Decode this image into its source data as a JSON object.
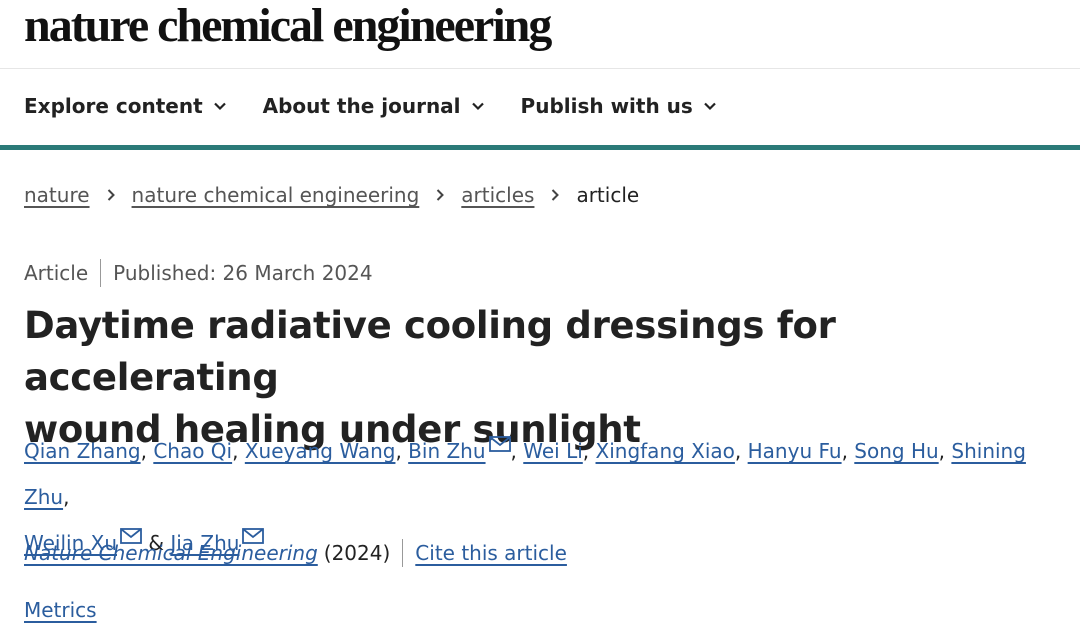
{
  "brand": {
    "name": "nature chemical engineering"
  },
  "nav": {
    "items": [
      {
        "label": "Explore content"
      },
      {
        "label": "About the journal"
      },
      {
        "label": "Publish with us"
      }
    ]
  },
  "breadcrumb": {
    "links": [
      "nature",
      "nature chemical engineering",
      "articles"
    ],
    "current": "article"
  },
  "meta": {
    "type": "Article",
    "published": "Published: 26 March 2024"
  },
  "article": {
    "title_line1": "Daytime radiative cooling dressings for accelerating",
    "title_line2": "wound healing under sunlight"
  },
  "authors": {
    "list": [
      "Qian Zhang",
      "Chao Qi",
      "Xueyang Wang",
      "Bin Zhu",
      "Wei Li",
      "Xingfang Xiao",
      "Hanyu Fu",
      "Song Hu",
      "Shining Zhu",
      "Weilin Xu",
      "Jia Zhu"
    ],
    "comma": ",",
    "ampersand": "&",
    "mail_icon": "mail-icon"
  },
  "citation": {
    "journal": "Nature Chemical Engineering",
    "year": "(2024)",
    "cite_label": "Cite this article"
  },
  "metrics": {
    "label": "Metrics"
  },
  "colors": {
    "accent": "#2b7a78",
    "link": "#2b5d9e",
    "text": "#222222",
    "muted": "#555555"
  }
}
